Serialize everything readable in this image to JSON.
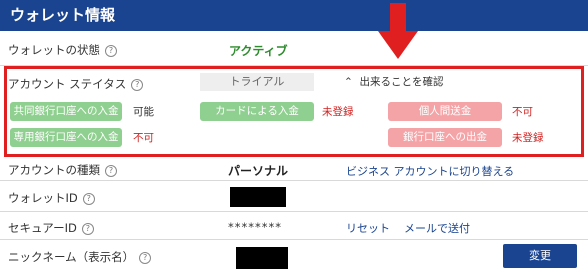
{
  "header": {
    "title": "ウォレット情報"
  },
  "wallet_status": {
    "label": "ウォレットの状態",
    "value": "アクティブ"
  },
  "account_status": {
    "label": "アカウント ステイタス",
    "trial_label": "トライアル",
    "check_link": "出来ることを確認",
    "items": [
      {
        "name": "共同銀行口座への入金",
        "status": "可能",
        "color": "#8fcf8f"
      },
      {
        "name": "カードによる入金",
        "status": "未登録",
        "color": "#8fcf8f"
      },
      {
        "name": "個人間送金",
        "status": "不可",
        "color": "#f4a3a6"
      },
      {
        "name": "専用銀行口座への入金",
        "status": "不可",
        "color": "#8fcf8f"
      },
      {
        "name": "銀行口座への出金",
        "status": "未登録",
        "color": "#f4a3a6"
      }
    ]
  },
  "account_type": {
    "label": "アカウントの種類",
    "value": "パーソナル",
    "link": "ビジネス アカウントに切り替える"
  },
  "wallet_id": {
    "label": "ウォレットID"
  },
  "secure_id": {
    "label": "セキュアーID",
    "value": "********",
    "reset": "リセット",
    "mail": "メールで送付"
  },
  "nickname": {
    "label": "ニックネーム（表示名）",
    "button": "変更"
  },
  "help_icon_glyph": "?",
  "colors": {
    "header": "#1a4490",
    "active": "#2e8b2e",
    "highlight_border": "#e02020",
    "arrow": "#e02020"
  }
}
